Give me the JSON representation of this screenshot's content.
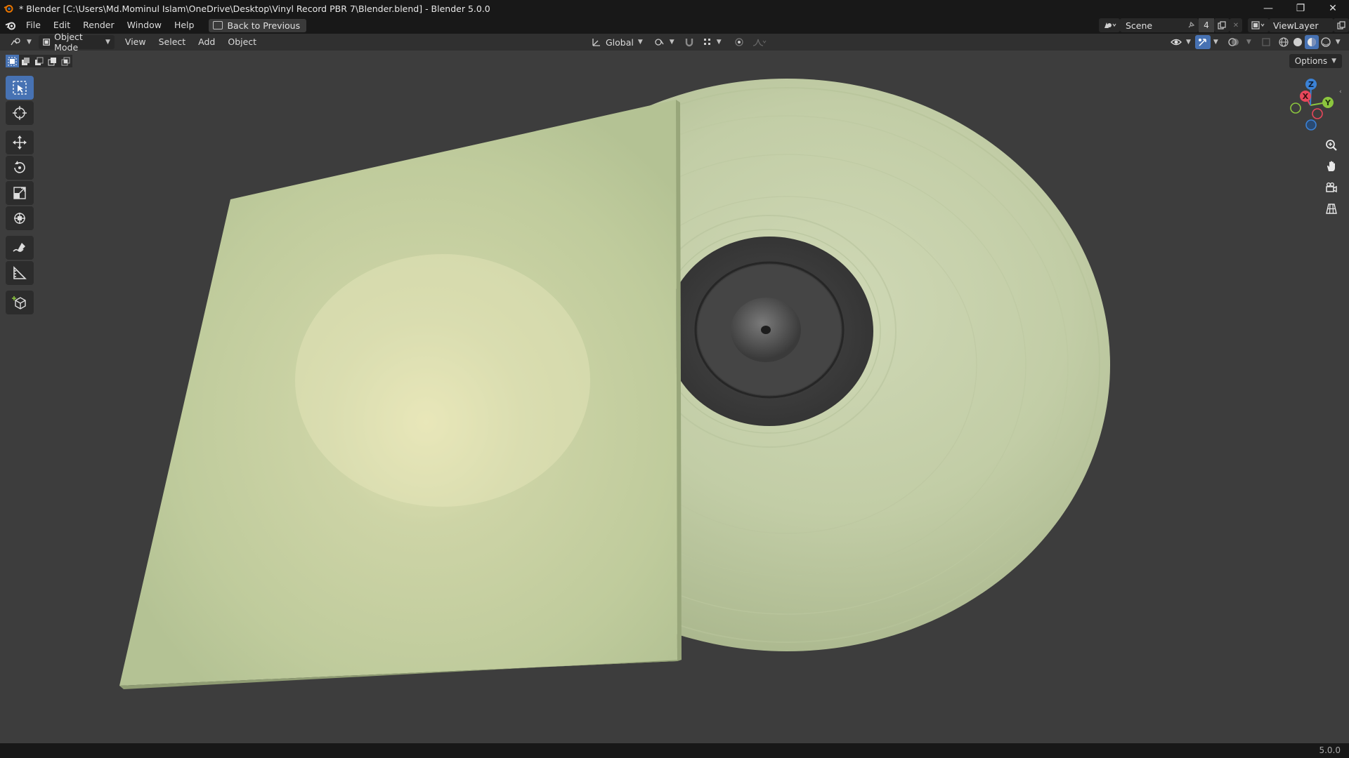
{
  "window": {
    "title": "* Blender [C:\\Users\\Md.Mominul Islam\\OneDrive\\Desktop\\Vinyl Record PBR 7\\Blender.blend] - Blender 5.0.0",
    "minimize": "—",
    "maximize": "❐",
    "close": "✕"
  },
  "menu": {
    "items": [
      "File",
      "Edit",
      "Render",
      "Window",
      "Help"
    ],
    "back_button": "Back to Previous"
  },
  "scene": {
    "name": "Scene",
    "user_count": "4",
    "view_layer": "ViewLayer"
  },
  "viewport_header": {
    "mode": "Object Mode",
    "menus": [
      "View",
      "Select",
      "Add",
      "Object"
    ],
    "orientation": "Global"
  },
  "options_label": "Options",
  "gizmo": {
    "x": "X",
    "y": "Y",
    "z": "Z"
  },
  "status": {
    "version": "5.0.0"
  },
  "colors": {
    "accent": "#4772b3",
    "vinyl": "#c5d0a8",
    "sleeve": "#c3cfa3",
    "label": "#3f3f3f",
    "axis_x": "#e8475b",
    "axis_y": "#8cc63e",
    "axis_z": "#3b82d6"
  },
  "icons": [
    "blender-logo",
    "editor-type-icon",
    "select-box-icon",
    "cursor-icon",
    "move-icon",
    "rotate-icon",
    "scale-icon",
    "transform-icon",
    "annotate-icon",
    "measure-icon",
    "add-cube-icon",
    "zoom-icon",
    "hand-icon",
    "camera-icon",
    "grid-icon"
  ]
}
